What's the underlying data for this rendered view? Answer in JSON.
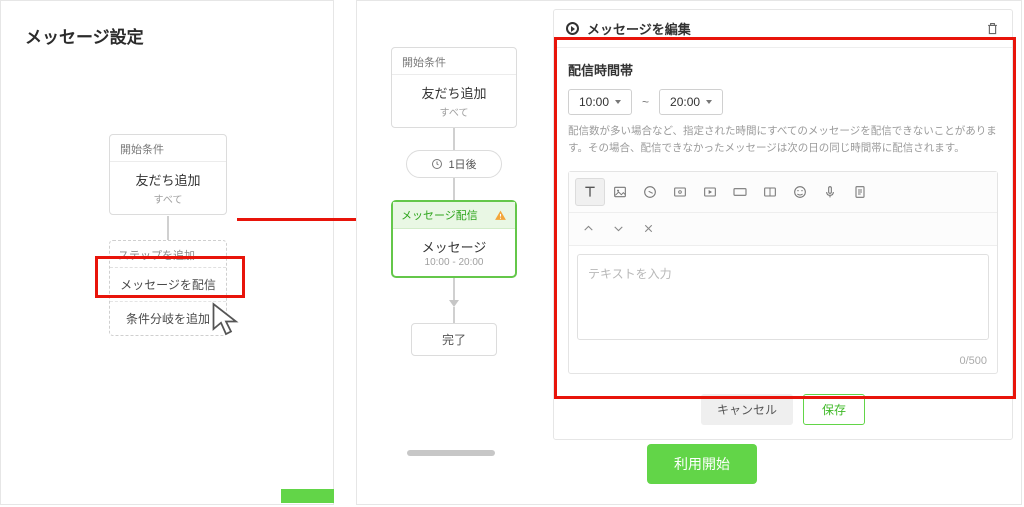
{
  "left": {
    "title": "メッセージ設定",
    "start": {
      "head": "開始条件",
      "label": "友だち追加",
      "sub": "すべて"
    },
    "add": {
      "head": "ステップを追加",
      "item1": "メッセージを配信",
      "item2": "条件分岐を追加"
    }
  },
  "right": {
    "start": {
      "head": "開始条件",
      "label": "友だち追加",
      "sub": "すべて"
    },
    "wait": "1日後",
    "msg": {
      "head": "メッセージ配信",
      "label": "メッセージ",
      "time": "10:00 - 20:00"
    },
    "done": "完了"
  },
  "edit": {
    "title": "メッセージを編集",
    "section": "配信時間帯",
    "time_from": "10:00",
    "tilde": "~",
    "time_to": "20:00",
    "help": "配信数が多い場合など、指定された時間にすべてのメッセージを配信できないことがあります。その場合、配信できなかったメッセージは次の日の同じ時間帯に配信されます。",
    "placeholder": "テキストを入力",
    "counter": "0/500",
    "cancel": "キャンセル",
    "save": "保存"
  },
  "start_button": "利用開始"
}
